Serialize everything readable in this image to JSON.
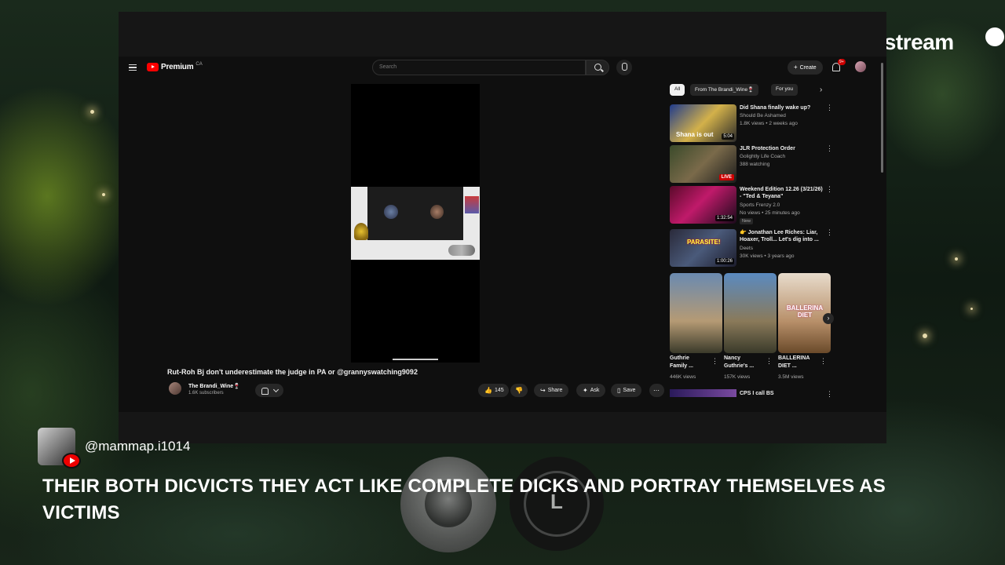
{
  "overlay": {
    "brand": "Restream",
    "commenter_handle": "@mammap.i1014",
    "comment_text": "THEIR BOTH DICVICTS THEY ACT LIKE COMPLETE DICKS AND PORTRAY THEMSELVES AS VICTIMS",
    "guest_initial": "L"
  },
  "youtube": {
    "logo_text": "Premium",
    "region": "CA",
    "search_placeholder": "Search",
    "create_label": "Create",
    "notification_count": "9+",
    "video": {
      "title": "Rut-Roh Bj don't underestimate the judge in PA or @grannyswatching9092",
      "channel": "The Brandi_Wine🍷",
      "subscribers": "1.6K subscribers",
      "likes": "145",
      "share": "Share",
      "ask": "Ask",
      "save": "Save"
    },
    "chips": [
      "All",
      "From The Brandi_Wine🍷",
      "For you"
    ],
    "recommendations": [
      {
        "title": "Did Shana finally wake up?",
        "channel": "Should Be Ashamed",
        "meta": "1.8K views • 2 weeks ago",
        "duration": "5:04",
        "thumb_text": "Shana is out"
      },
      {
        "title": "JLR Protection Order",
        "channel": "Golightly Life Coach",
        "meta": "388 watching",
        "duration": "LIVE"
      },
      {
        "title": "Weekend Edition 12.26 (3/21/26) - \"Ted & Teyana\"",
        "channel": "Sports Frenzy 2.0",
        "meta": "No views • 25 minutes ago",
        "duration": "1:32:54",
        "badge": "New"
      },
      {
        "title": "👉 Jonathan Lee Riches: Liar, Hoaxer, Troll... Let's dig into ...",
        "channel": "Deets",
        "meta": "30K views • 3 years ago",
        "duration": "1:00:26",
        "thumb_text": "PARASITE!"
      }
    ],
    "shorts": [
      {
        "title": "Guthrie Family ...",
        "views": "446K views"
      },
      {
        "title": "Nancy Guthrie's ...",
        "views": "157K views"
      },
      {
        "title": "BALLERINA DIET ...",
        "views": "3.5M views",
        "thumb_text": "BALLERINA DIET"
      }
    ],
    "next_item": "CPS I call BS"
  }
}
